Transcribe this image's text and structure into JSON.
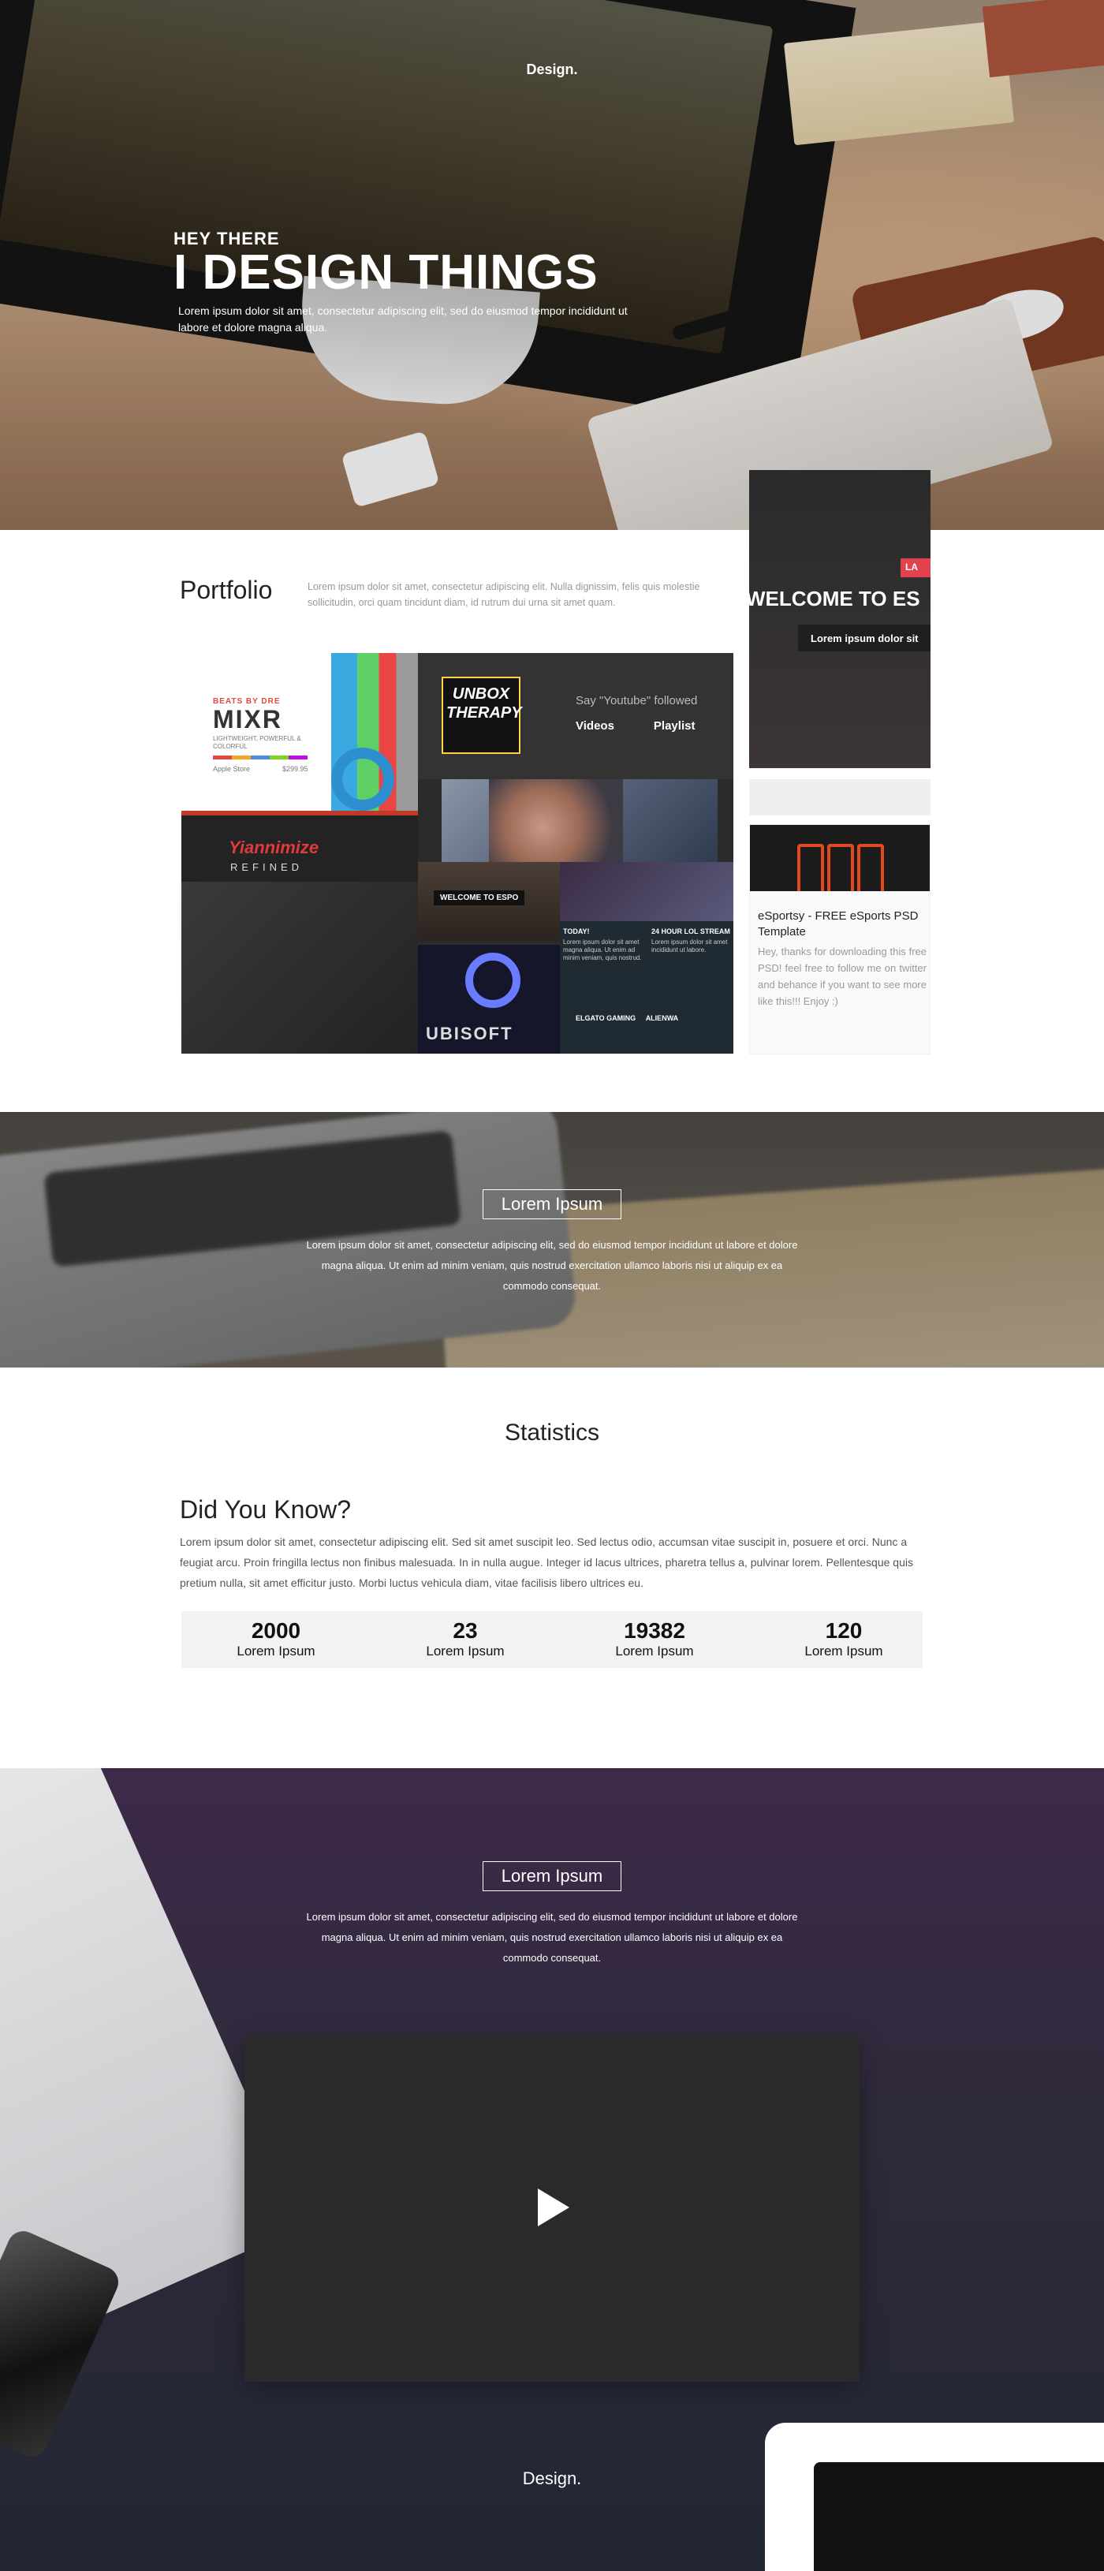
{
  "header": {
    "logo": "Design",
    "logo_dot": "."
  },
  "hero": {
    "kicker": "HEY THERE",
    "title": "I DESIGN THINGS",
    "description": "Lorem ipsum dolor sit amet, consectetur adipiscing elit, sed do eiusmod tempor incididunt ut labore et dolore magna aliqua."
  },
  "portfolio": {
    "title": "Portfolio",
    "description": "Lorem ipsum dolor sit amet, consectetur adipiscing elit. Nulla dignissim, felis quis molestie sollicitudin, orci quam tincidunt diam, id rutrum dui urna sit amet quam.",
    "mosaic": {
      "mixr_small": "BEATS BY DRE",
      "mixr_big": "MIXR",
      "mixr_tag": "LIGHTWEIGHT, POWERFUL & COLORFUL",
      "mixr_brand": "Apple Store",
      "mixr_price": "$299.95",
      "unbox_line1": "UNBOX",
      "unbox_line2": "THERAPY",
      "yt_say": "Say \"Youtube\" followed",
      "yt_videos": "Videos",
      "yt_playlists": "Playlist",
      "yiannimize": "Yiannimize",
      "refined": "REFINED",
      "welcome_mini": "WELCOME TO ESPO",
      "ubisoft": "UBISOFT",
      "news_col1_title": "TODAY!",
      "news_col1_body": "Lorem ipsum dolor sit amet magna aliqua. Ut enim ad minim veniam, quis nostrud.",
      "news_col2_title": "24 HOUR LOL STREAM",
      "news_col2_body": "Lorem ipsum dolor sit amet incididunt ut labore.",
      "news_foot_left": "ELGATO GAMING",
      "news_foot_right": "ALIENWA"
    },
    "side_preview": {
      "badge": "LA",
      "welcome": "WELCOME TO ES",
      "sub": "Lorem ipsum dolor sit"
    },
    "card": {
      "title": "eSportsy - FREE eSports PSD Template",
      "body": "Hey, thanks for downloading this free PSD! feel free to follow me on twitter and behance if you want to see more like this!!! Enjoy :)"
    }
  },
  "band1": {
    "heading": "Lorem Ipsum",
    "description": "Lorem ipsum dolor sit amet, consectetur adipiscing elit, sed do eiusmod tempor incididunt ut labore et dolore magna aliqua. Ut enim ad minim veniam, quis nostrud exercitation ullamco laboris nisi ut aliquip ex ea commodo consequat."
  },
  "statistics": {
    "title": "Statistics",
    "did_you_know": "Did You Know?",
    "description": "Lorem ipsum dolor sit amet, consectetur adipiscing elit. Sed sit amet suscipit leo. Sed lectus odio, accumsan vitae suscipit in, posuere et orci. Nunc a feugiat arcu. Proin fringilla lectus non finibus malesuada. In in nulla augue. Integer id lacus ultrices, pharetra tellus a, pulvinar lorem. Pellentesque quis pretium nulla, sit amet efficitur justo. Morbi luctus vehicula diam, vitae facilisis libero ultrices eu.",
    "items": [
      {
        "value": "2000",
        "label": "Lorem Ipsum"
      },
      {
        "value": "23",
        "label": "Lorem Ipsum"
      },
      {
        "value": "19382",
        "label": "Lorem Ipsum"
      },
      {
        "value": "120",
        "label": "Lorem Ipsum"
      }
    ]
  },
  "band2": {
    "heading": "Lorem Ipsum",
    "description": "Lorem ipsum dolor sit amet, consectetur adipiscing elit, sed do eiusmod tempor incididunt ut labore et dolore magna aliqua. Ut enim ad minim veniam, quis nostrud exercitation ullamco laboris nisi ut aliquip ex ea commodo consequat."
  },
  "video": {
    "icon": "play-icon"
  },
  "footer": {
    "logo": "Design."
  },
  "colors": {
    "accent_red": "#e0424e",
    "dark_purple": "#3d2a49",
    "stats_bg": "#f2f2f2"
  }
}
